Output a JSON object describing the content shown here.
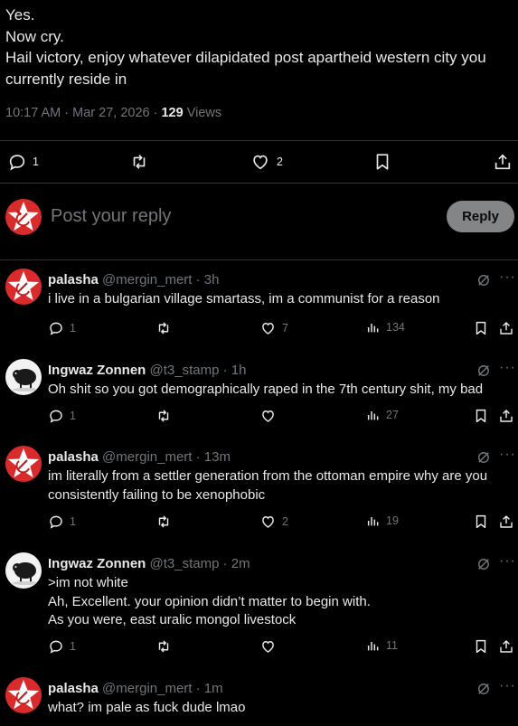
{
  "post": {
    "lines": [
      "Yes.",
      "Now cry.",
      "Hail victory, enjoy whatever dilapidated post apartheid western city you",
      "currently reside in"
    ],
    "timestamp": "10:17 AM · Mar 27, 2026 ·",
    "views_count": "129",
    "views_label": "Views",
    "reply_count": "1",
    "retweet_count": "",
    "like_count": "2"
  },
  "composer": {
    "placeholder": "Post your reply",
    "button": "Reply"
  },
  "replies": [
    {
      "name": "palasha",
      "handle": "@mergin_mert · 3h",
      "lines": [
        "i live in a bulgarian village smartass, im a communist for a reason"
      ],
      "replies": "1",
      "likes": "7",
      "views": "134",
      "avatar": "star-hammer-sickle"
    },
    {
      "name": "Ingwaz Zonnen",
      "handle": "@t3_stamp · 1h",
      "lines": [
        "Oh shit so you got demographically raped in the 7th century shit, my bad"
      ],
      "replies": "1",
      "likes": "",
      "views": "27",
      "avatar": "sheep"
    },
    {
      "name": "palasha",
      "handle": "@mergin_mert · 13m",
      "lines": [
        "im literally from a settler generation from the ottoman empire why are you",
        "consistently failing to be xenophobic"
      ],
      "replies": "1",
      "likes": "2",
      "views": "19",
      "avatar": "star-hammer-sickle"
    },
    {
      "name": "Ingwaz Zonnen",
      "handle": "@t3_stamp · 2m",
      "lines": [
        ">im not white",
        "Ah, Excellent.  your opinion didn’t matter to begin with.",
        "As you were, east uralic mongol livestock"
      ],
      "replies": "1",
      "likes": "",
      "views": "11",
      "avatar": "sheep"
    },
    {
      "name": "palasha",
      "handle": "@mergin_mert · 1m",
      "lines": [
        "what? im pale as fuck dude lmao"
      ],
      "replies": "",
      "likes": "",
      "views": "",
      "avatar": "star-hammer-sickle"
    }
  ]
}
